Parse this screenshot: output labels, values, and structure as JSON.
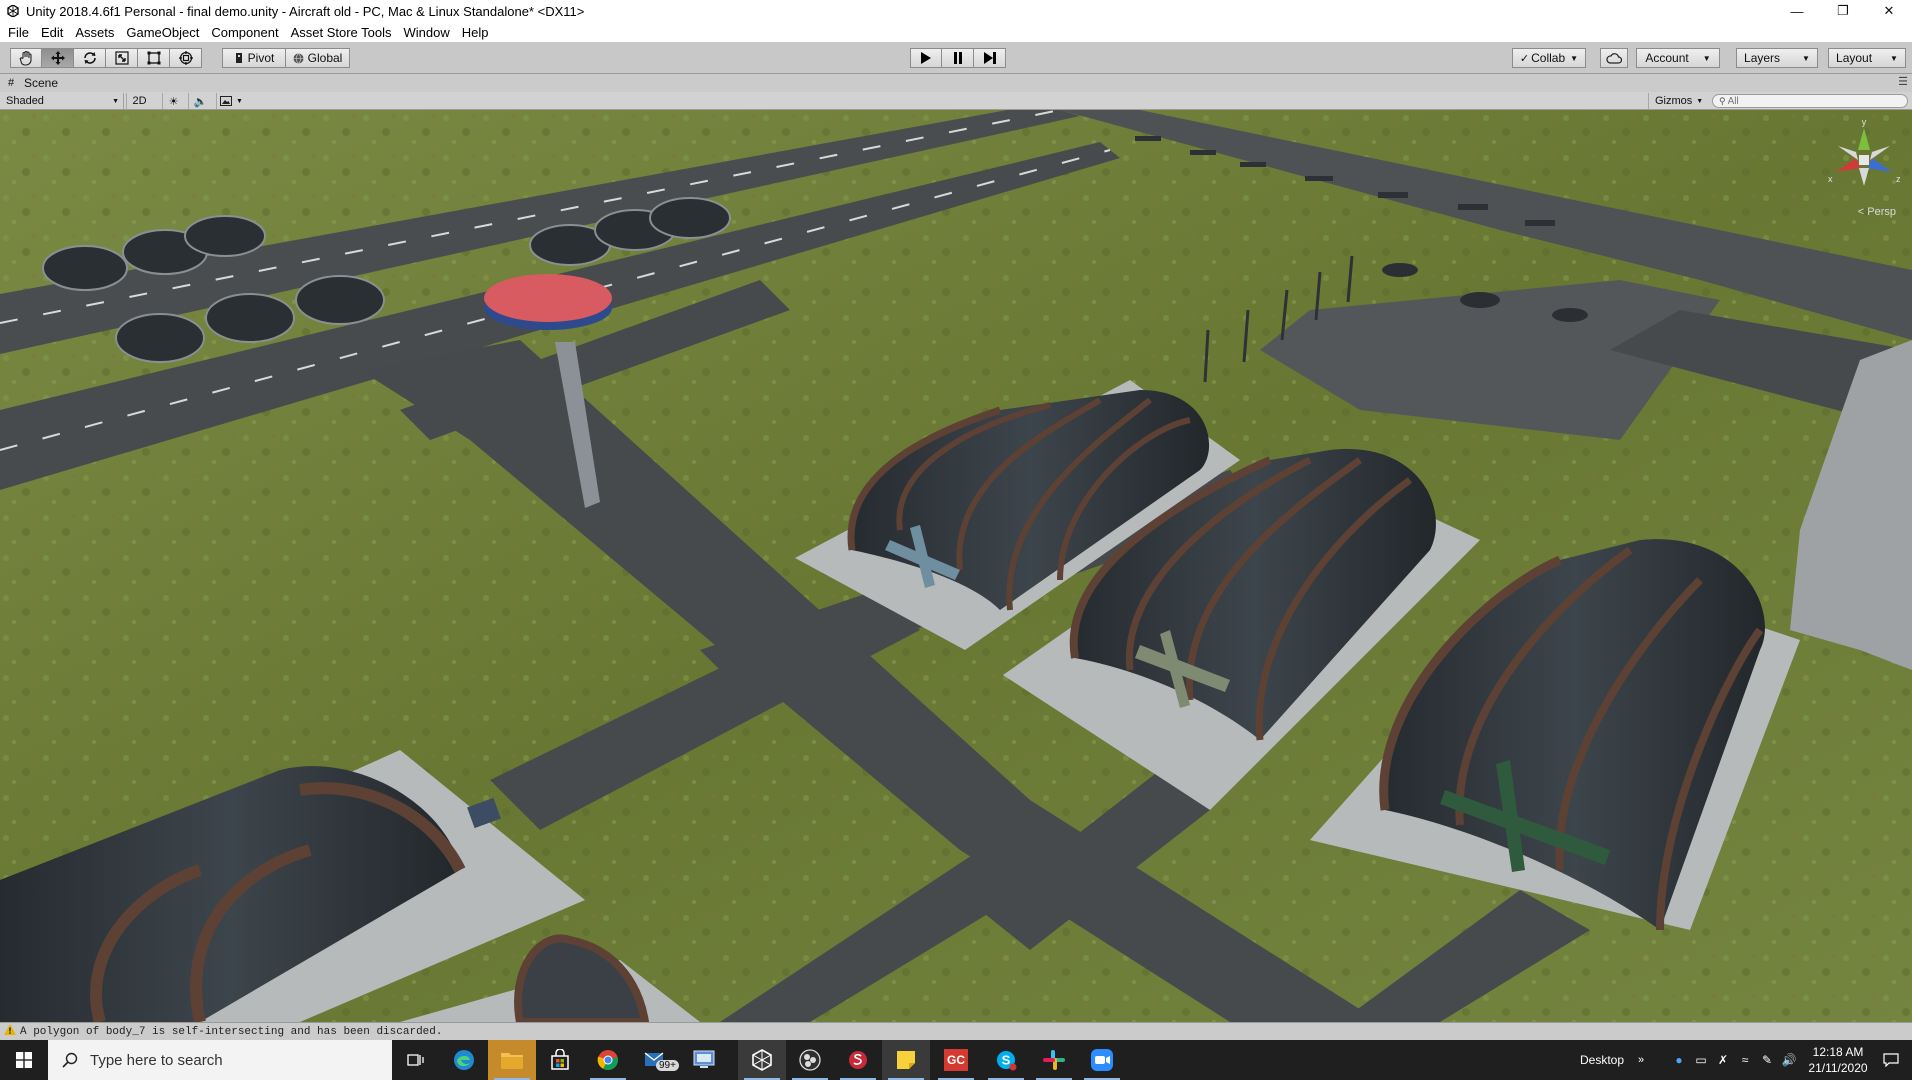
{
  "window": {
    "title": "Unity 2018.4.6f1 Personal - final demo.unity - Aircraft old - PC, Mac & Linux Standalone* <DX11>",
    "controls": [
      "minimize-icon",
      "restore-icon",
      "close-icon"
    ]
  },
  "menu": {
    "items": [
      "File",
      "Edit",
      "Assets",
      "GameObject",
      "Component",
      "Asset Store Tools",
      "Window",
      "Help"
    ]
  },
  "toolbar": {
    "transform_tools": [
      "hand-icon",
      "move-icon",
      "rotate-icon",
      "scale-icon",
      "rect-icon",
      "transform-icon"
    ],
    "active_tool": "move-icon",
    "pivot_label": "Pivot",
    "global_label": "Global",
    "play_controls": [
      "play-icon",
      "pause-icon",
      "step-icon"
    ],
    "collab_label": "Collab",
    "account_label": "Account",
    "layers_label": "Layers",
    "layout_label": "Layout"
  },
  "scene": {
    "tab_label": "Scene",
    "shading_mode": "Shaded",
    "mode_2d_label": "2D",
    "gizmos_label": "Gizmos",
    "search_placeholder": "All",
    "projection_label": "< Persp",
    "gizmo_axes": {
      "x": "x",
      "y": "y",
      "z": "z"
    }
  },
  "console": {
    "message": "A polygon of body_7 is self-intersecting and has been discarded."
  },
  "taskbar": {
    "search_placeholder": "Type here to search",
    "apps": [
      "task-view-icon",
      "edge-icon",
      "file-explorer-icon",
      "store-icon",
      "chrome-icon",
      "mail-icon",
      "remote-icon",
      "unity-icon",
      "obs-icon",
      "app-icon",
      "sticky-notes-icon",
      "gc-icon",
      "skype-icon",
      "slack-icon",
      "zoom-icon"
    ],
    "mail_badge": "99+",
    "gc_label": "GC",
    "desktop_label": "Desktop",
    "tray_chevron": "»",
    "time": "12:18 AM",
    "date": "21/11/2020"
  },
  "colors": {
    "grass": "#6e7c38",
    "runway": "#45484b",
    "pad": "#b9bcbd",
    "hangar": "#2b3035",
    "rib": "#5a3e33",
    "tower_top": "#d85a63"
  }
}
